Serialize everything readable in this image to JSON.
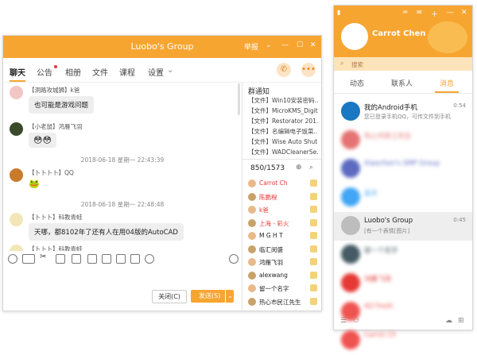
{
  "group_window": {
    "title": "Luobo's Group",
    "title_action": "举报",
    "tabs": [
      "聊天",
      "公告",
      "相册",
      "文件",
      "课程",
      "设置"
    ],
    "messages": [
      {
        "sender": "【洞路攻城狮】k爸",
        "text": "也可能是游戏问题"
      },
      {
        "sender": "【小老鼠】鸿雁飞羽",
        "text": "😳😳"
      },
      {
        "timestamp": "2018-06-18 星期一 22:43:39"
      },
      {
        "sender": "【卜卜卜卜】QQ",
        "text": "🐸"
      },
      {
        "timestamp": "2018-06-18 星期一 22:48:48"
      },
      {
        "sender": "【卜卜卜】科教青蛙",
        "text": "天哪，都8102年了还有人在用04版的AutoCAD"
      },
      {
        "sender": "【卜卜卜】科教青蛙",
        "text": ""
      }
    ],
    "close_label": "关闭(C)",
    "send_label": "发送(S)",
    "notice": {
      "title": "群通知",
      "items": [
        "【文件】Win10安装密码...",
        "【文件】MicroKMS_Digit...",
        "【文件】Restorator 201...",
        "【文件】名编辑电子饭菜...",
        "【文件】Wise Auto Shut...",
        "【文件】WADCleanerSe..."
      ]
    },
    "member_count": "850/1573",
    "members": [
      {
        "name": "Carrot Ch",
        "color": "#e53935"
      },
      {
        "name": "陈鹏程",
        "color": "#e53935"
      },
      {
        "name": "k爸",
        "color": "#e53935"
      },
      {
        "name": "上海 - 彩火",
        "color": "#e53935"
      },
      {
        "name": "M G H T",
        "color": "#222222"
      },
      {
        "name": "临汇闵盛",
        "color": "#222222"
      },
      {
        "name": "鸿雁飞羽",
        "color": "#222222"
      },
      {
        "name": "alexwang",
        "color": "#222222"
      },
      {
        "name": "留一个名字",
        "color": "#222222"
      },
      {
        "name": "热心市民江先生",
        "color": "#222222"
      }
    ]
  },
  "main_panel": {
    "profile_name": "Carrot Chen",
    "search_placeholder": "搜索",
    "tabs": [
      "动态",
      "联系人",
      "消息"
    ],
    "conversations": [
      {
        "name": "我的Android手机",
        "sub": "您已登录手机QQ，可传文件到手机",
        "time": "0:54",
        "blurred": false,
        "color": "#1a78c2"
      },
      {
        "name": "热心市民江先生",
        "sub": "",
        "time": "",
        "blurred": true,
        "color": "#e57373"
      },
      {
        "name": "Xiaochen's SMP Group",
        "sub": "",
        "time": "",
        "blurred": true,
        "color": "#5c6bc0"
      },
      {
        "name": "蓝天",
        "sub": "",
        "time": "",
        "blurred": true,
        "color": "#42a5f5"
      },
      {
        "name": "Luobo's Group",
        "sub": "[有一个表情[图片]",
        "time": "0:45",
        "blurred": false,
        "color": "#bdbdbd"
      },
      {
        "name": "留一个名字",
        "sub": "",
        "time": "",
        "blurred": true,
        "color": "#455a64"
      },
      {
        "name": "鸿雁飞羽",
        "sub": "",
        "time": "",
        "blurred": true,
        "color": "#e53935"
      },
      {
        "name": "AO fresh",
        "sub": "",
        "time": "",
        "blurred": true,
        "color": "#ef5350"
      },
      {
        "name": "Carrot Ch",
        "sub": "",
        "time": "",
        "blurred": true,
        "color": "#ef5350"
      }
    ]
  },
  "colors": {
    "accent": "#f7a531",
    "mention": "#e53935"
  }
}
